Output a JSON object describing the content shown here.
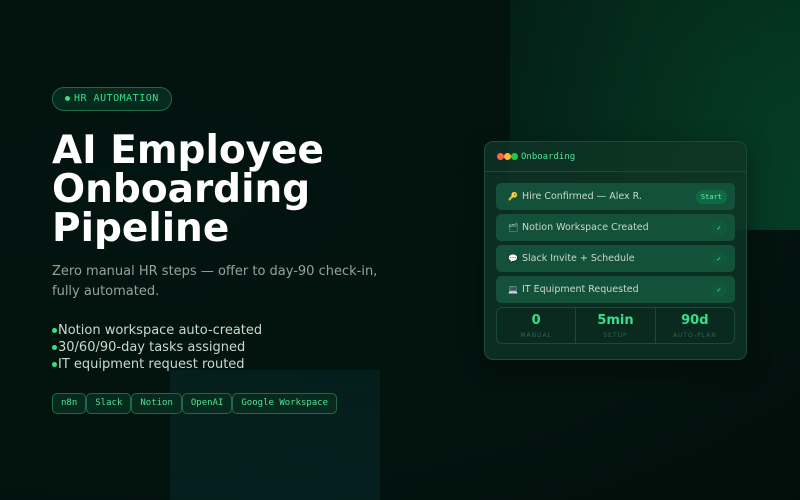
{
  "hero": {
    "eyebrow": "HR AUTOMATION",
    "title_line1": "AI Employee",
    "title_line2": "Onboarding",
    "title_line3": "Pipeline",
    "subtitle": "Zero manual HR steps — offer to day-90 check-in, fully automated.",
    "bullets": [
      "Notion workspace auto-created",
      "30/60/90-day tasks assigned",
      "IT equipment request routed"
    ],
    "tags": [
      "n8n",
      "Slack",
      "Notion",
      "OpenAI",
      "Google Workspace"
    ]
  },
  "card": {
    "title": "Onboarding",
    "steps": [
      {
        "icon": "key-icon",
        "glyph": "🔑",
        "label": "Hire Confirmed — Alex R.",
        "status": "Start"
      },
      {
        "icon": "folder-icon",
        "glyph": "🗂",
        "label": "Notion Workspace Created",
        "status": "✓"
      },
      {
        "icon": "chat-icon",
        "glyph": "💬",
        "label": "Slack Invite + Schedule",
        "status": "✓"
      },
      {
        "icon": "laptop-icon",
        "glyph": "💻",
        "label": "IT Equipment Requested",
        "status": "✓"
      }
    ],
    "stats": [
      {
        "value": "0",
        "label": "MANUAL"
      },
      {
        "value": "5min",
        "label": "SETUP"
      },
      {
        "value": "90d",
        "label": "AUTO-PLAN"
      }
    ]
  },
  "colors": {
    "accent": "#36e08a",
    "background": "#031510",
    "card": "#14513a"
  }
}
